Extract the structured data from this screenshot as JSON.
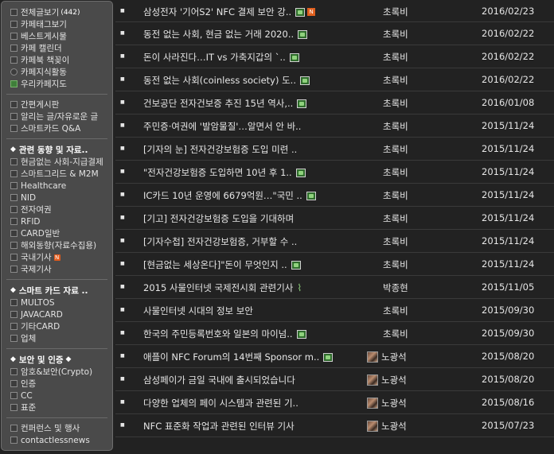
{
  "sidebar": {
    "top_items": [
      {
        "label": "전체글보기",
        "count": "(442)",
        "icon": "list-icon"
      },
      {
        "label": "카페태그보기",
        "icon": "tag-icon"
      },
      {
        "label": "베스트게시물",
        "icon": "best-icon"
      },
      {
        "label": "카페 캘린더",
        "icon": "calendar-icon"
      },
      {
        "label": "카페북 책꽂이",
        "icon": "book-icon"
      },
      {
        "label": "카페지식활동",
        "icon": "knowledge-icon"
      },
      {
        "label": "우리카페지도",
        "icon": "map-icon"
      }
    ],
    "board_items": [
      {
        "label": "간편게시판"
      },
      {
        "label": "알리는 글/자유로운 글"
      },
      {
        "label": "스마트카드 Q&A"
      }
    ],
    "section1": {
      "header": "관련 동향 및 자료..",
      "items": [
        {
          "label": "현금없는 사회-지급결제"
        },
        {
          "label": "스마트그리드 & M2M"
        },
        {
          "label": "Healthcare"
        },
        {
          "label": "NID"
        },
        {
          "label": "전자여권"
        },
        {
          "label": "RFID"
        },
        {
          "label": "CARD일반"
        },
        {
          "label": "해외동향(자료수집용)"
        },
        {
          "label": "국내기사",
          "new": "N"
        },
        {
          "label": "국제기사"
        }
      ]
    },
    "section2": {
      "header": "스마트 카드 자료 ..",
      "items": [
        {
          "label": "MULTOS"
        },
        {
          "label": "JAVACARD"
        },
        {
          "label": "기타CARD"
        },
        {
          "label": "업체"
        }
      ]
    },
    "section3": {
      "header": "보안 및 인증",
      "items": [
        {
          "label": "암호&보안(Crypto)"
        },
        {
          "label": "인증"
        },
        {
          "label": "CC"
        },
        {
          "label": "표준"
        }
      ]
    },
    "bottom_items": [
      {
        "label": "컨퍼런스 및 행사"
      },
      {
        "label": "contactlessnews"
      }
    ]
  },
  "posts": [
    {
      "title": "삼성전자 '기어S2' NFC 결제 보안 강..",
      "author": "초록비",
      "date": "2016/02/23",
      "has_image": true,
      "is_new": true
    },
    {
      "title": "동전 없는 사회, 현금 없는 거래 2020..",
      "author": "초록비",
      "date": "2016/02/22",
      "has_image": true
    },
    {
      "title": "돈이 사라진다…IT vs 가축지갑의 `..",
      "author": "초록비",
      "date": "2016/02/22",
      "has_image": true
    },
    {
      "title": "동전 없는 사회(coinless society) 도..",
      "author": "초록비",
      "date": "2016/02/22",
      "has_image": true
    },
    {
      "title": "건보공단 전자건보증 추진 15년 역사,..",
      "author": "초록비",
      "date": "2016/01/08",
      "has_image": true
    },
    {
      "title": "주민증·여권에 '발암물질'…알면서 안 바..",
      "author": "초록비",
      "date": "2015/11/24"
    },
    {
      "title": "[기자의 눈] 전자건강보험증 도입 미련 ..",
      "author": "초록비",
      "date": "2015/11/24"
    },
    {
      "title": "\"전자건강보험증 도입하면 10년 후 1..",
      "author": "초록비",
      "date": "2015/11/24",
      "has_image": true
    },
    {
      "title": "IC카드 10년 운영에 6679억원…\"국민 ..",
      "author": "초록비",
      "date": "2015/11/24",
      "has_image": true
    },
    {
      "title": "[기고] 전자건강보험증 도입을 기대하며",
      "author": "초록비",
      "date": "2015/11/24"
    },
    {
      "title": "[기자수첩] 전자건강보험증, 거부할 수 ..",
      "author": "초록비",
      "date": "2015/11/24"
    },
    {
      "title": "[현금없는 세상온다]\"돈이 무엇인지 ..",
      "author": "초록비",
      "date": "2015/11/24",
      "has_image": true
    },
    {
      "title": "2015 사물인터넷 국제전시회 관련기사",
      "author": "박종현",
      "date": "2015/11/05",
      "has_attachment": true
    },
    {
      "title": "사물인터넷 시대의 정보 보안",
      "author": "초록비",
      "date": "2015/09/30"
    },
    {
      "title": "한국의 주민등록번호와 일본의 마이넘..",
      "author": "초록비",
      "date": "2015/09/30",
      "has_image": true
    },
    {
      "title": "애플이 NFC Forum의 14번째 Sponsor m..",
      "author": "노광석",
      "date": "2015/08/20",
      "has_image": true,
      "has_avatar": true
    },
    {
      "title": "삼성페이가 금일 국내에 출시되었습니다",
      "author": "노광석",
      "date": "2015/08/20",
      "has_avatar": true
    },
    {
      "title": "다양한 업체의 페이 시스템과 관련된 기..",
      "author": "노광석",
      "date": "2015/08/16",
      "has_avatar": true
    },
    {
      "title": "NFC 표준화 작업과 관련된 인터뷰 기사",
      "author": "노광석",
      "date": "2015/07/23",
      "has_avatar": true
    }
  ],
  "icons": {
    "bullet": "bullet-icon",
    "image": "image-attached-icon",
    "new": "new-badge-icon",
    "attachment": "paperclip-icon",
    "avatar": "user-avatar"
  },
  "colors": {
    "background": "#222222",
    "sidebar": "#4a4a4a",
    "image_icon": "#2f6b2c",
    "new_badge": "#e0601f"
  }
}
